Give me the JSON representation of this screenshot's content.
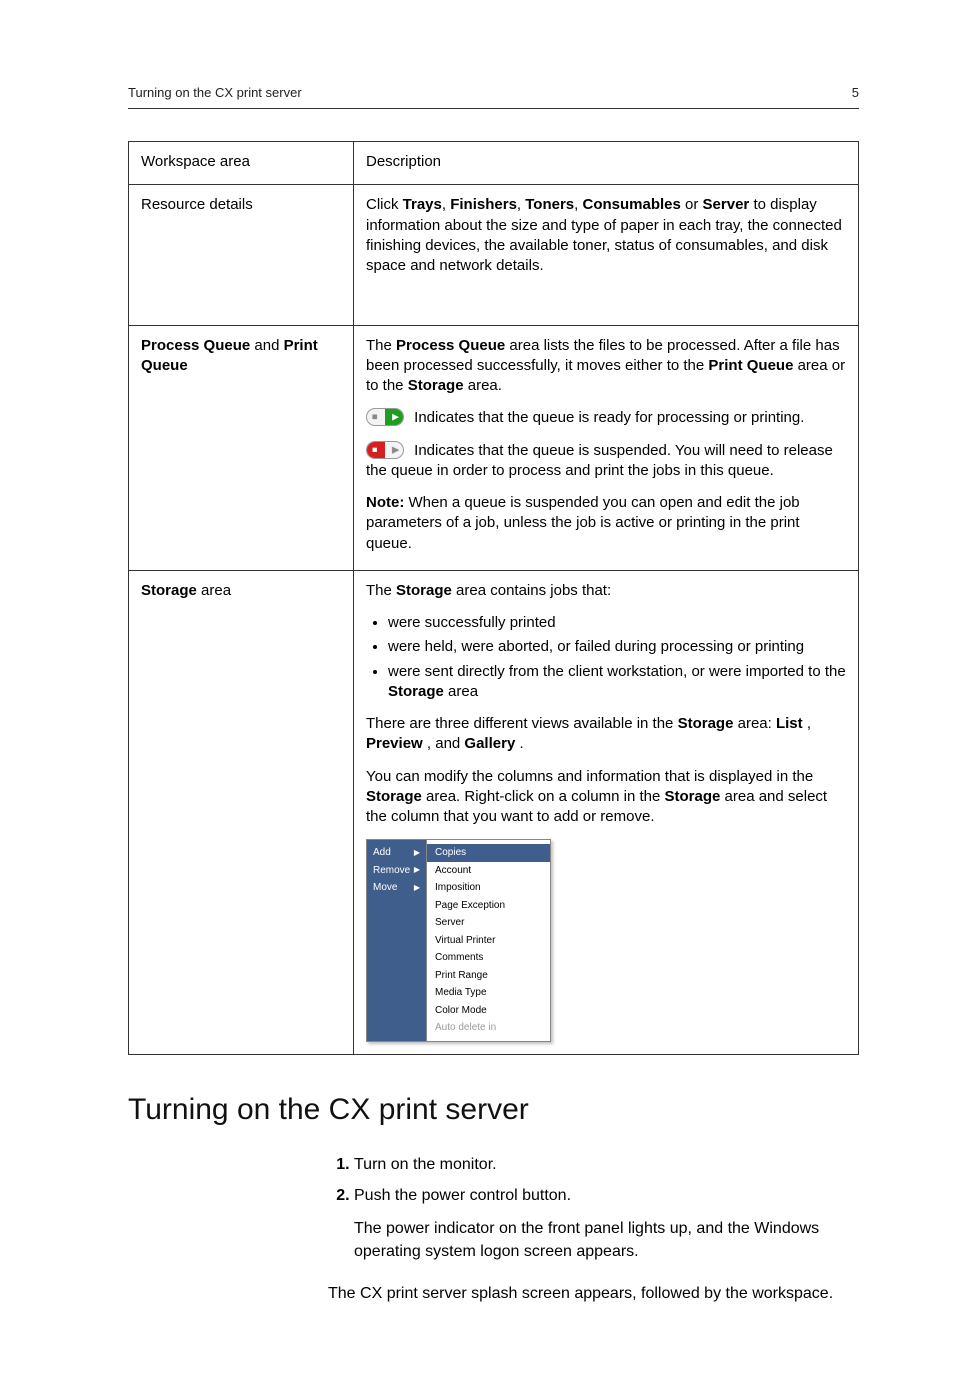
{
  "header": {
    "running_title": "Turning on the CX print server",
    "page_number": "5"
  },
  "table": {
    "head": {
      "c1": "Workspace area",
      "c2": "Description"
    },
    "rows": {
      "resource": {
        "label": "Resource details",
        "desc": {
          "pre": "Click ",
          "b1": "Trays",
          "s1": ", ",
          "b2": "Finishers",
          "s2": ", ",
          "b3": "Toners",
          "s3": ", ",
          "b4": "Consumables",
          "s4": " or ",
          "b5": "Server",
          "post": " to display information about the size and type of paper in each tray, the connected finishing devices, the available toner, status of consumables, and disk space and network details."
        }
      },
      "queues": {
        "label": {
          "b1": "Process Queue",
          "mid": " and ",
          "b2": "Print Queue"
        },
        "p1": {
          "pre": "The ",
          "b1": "Process Queue",
          "mid": " area lists the files to be processed. After a file has been processed successfully, it moves either to the ",
          "b2": "Print Queue",
          "mid2": " area or to the ",
          "b3": "Storage",
          "post": " area."
        },
        "p2": " Indicates that the queue is ready for processing or printing.",
        "p3": " Indicates that the queue is suspended. You will need to release the queue in order to process and print the jobs in this queue.",
        "p4": {
          "b": "Note:",
          "t": " When a queue is suspended you can open and edit the job parameters of a job, unless the job is active or printing in the print queue."
        }
      },
      "storage": {
        "label": {
          "b": "Storage",
          "t": " area"
        },
        "p1": {
          "pre": "The ",
          "b": "Storage",
          "post": " area contains jobs that:"
        },
        "li1": "were successfully printed",
        "li2": "were held, were aborted, or failed during processing or printing",
        "li3": {
          "pre": "were sent directly from the client workstation, or were imported to the ",
          "b": "Storage",
          "post": " area"
        },
        "p2": {
          "pre": "There are three different views available in the ",
          "b1": "Storage",
          "mid1": " area: ",
          "b2": "List",
          "mid2": ", ",
          "b3": "Preview",
          "mid3": ", and ",
          "b4": "Gallery",
          "post": "."
        },
        "p3": {
          "pre": "You can modify the columns and information that is displayed in the ",
          "b1": "Storage",
          "mid1": " area. Right-click on a column in the ",
          "b2": "Storage",
          "post": " area and select the column that you want to add or remove."
        },
        "menu": {
          "colA": {
            "add": "Add",
            "remove": "Remove",
            "move": "Move"
          },
          "colB": {
            "copies": "Copies",
            "account": "Account",
            "imposition": "Imposition",
            "page_exception": "Page Exception",
            "server": "Server",
            "virtual_printer": "Virtual Printer",
            "comments": "Comments",
            "print_range": "Print Range",
            "media_type": "Media Type",
            "color_mode": "Color Mode",
            "auto_delete_in": "Auto delete in"
          }
        }
      }
    }
  },
  "section": {
    "title": "Turning on the CX print server",
    "steps": {
      "s1": "Turn on the monitor.",
      "s2": "Push the power control button.",
      "s2_sub": "The power indicator on the front panel lights up, and the Windows operating system logon screen appears."
    },
    "trail": "The CX print server splash screen appears, followed by the workspace."
  }
}
